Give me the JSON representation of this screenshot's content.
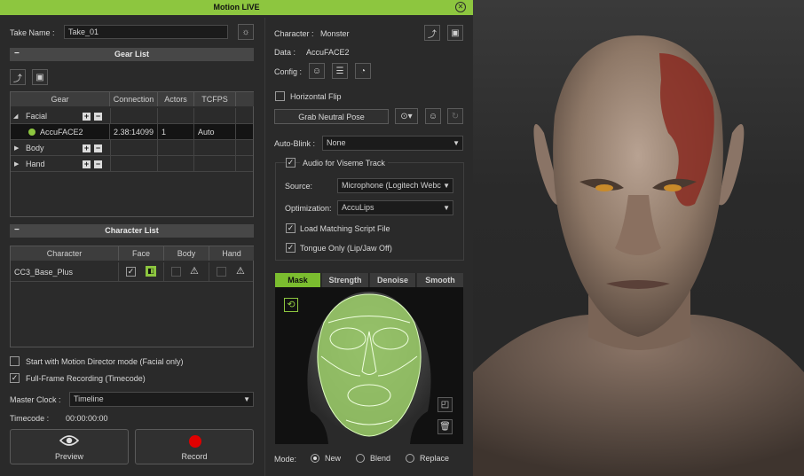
{
  "window": {
    "title": "Motion LIVE",
    "close_icon": "close-icon"
  },
  "take": {
    "label": "Take Name :",
    "value": "Take_01"
  },
  "gear_list": {
    "title": "Gear List",
    "columns": [
      "Gear",
      "Connection",
      "Actors",
      "TCFPS"
    ],
    "rows": [
      {
        "name": "Facial",
        "connection": "",
        "actors": "",
        "tcfps": ""
      },
      {
        "name": "AccuFACE2",
        "connection": "2.38:14099",
        "actors": "1",
        "tcfps": "Auto"
      },
      {
        "name": "Body",
        "connection": "",
        "actors": "",
        "tcfps": ""
      },
      {
        "name": "Hand",
        "connection": "",
        "actors": "",
        "tcfps": ""
      }
    ]
  },
  "character_list": {
    "title": "Character List",
    "columns": [
      "Character",
      "Face",
      "Body",
      "Hand"
    ],
    "rows": [
      {
        "name": "CC3_Base_Plus"
      }
    ]
  },
  "options": {
    "motion_director": "Start with Motion Director mode (Facial only)",
    "full_frame": "Full-Frame Recording (Timecode)",
    "master_clock_label": "Master Clock :",
    "master_clock_value": "Timeline",
    "timecode_label": "Timecode :",
    "timecode_value": "00:00:00:00"
  },
  "buttons": {
    "preview": "Preview",
    "record": "Record",
    "record_color": "#e00000"
  },
  "right": {
    "character_label": "Character :",
    "character_value": "Monster",
    "data_label": "Data :",
    "data_value": "AccuFACE2",
    "config_label": "Config :",
    "horizontal_flip": "Horizontal Flip",
    "grab_neutral": "Grab Neutral Pose",
    "auto_blink_label": "Auto-Blink :",
    "auto_blink_value": "None",
    "audio_viseme": "Audio for Viseme Track",
    "source_label": "Source:",
    "source_value": "Microphone (Logitech Webca",
    "optimization_label": "Optimization:",
    "optimization_value": "AccuLips",
    "load_script": "Load Matching Script File",
    "tongue_only": "Tongue Only (Lip/Jaw Off)"
  },
  "tabs": [
    "Mask",
    "Strength",
    "Denoise",
    "Smooth"
  ],
  "mode": {
    "label": "Mode:",
    "options": [
      "New",
      "Blend",
      "Replace"
    ]
  },
  "colors": {
    "accent": "#8dc63f",
    "panel": "#2a2a2a"
  }
}
